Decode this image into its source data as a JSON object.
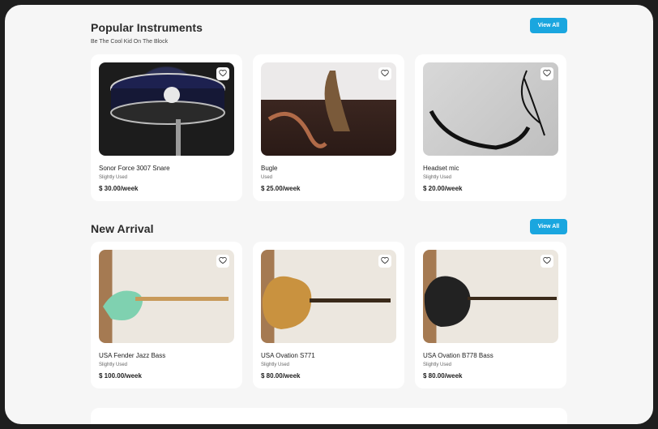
{
  "popular": {
    "title": "Popular Instruments",
    "subtitle": "Be The Cool Kid On The Block",
    "view_all": "View All",
    "items": [
      {
        "name": "Sonor Force 3007 Snare",
        "condition": "Slightly Used",
        "price": "$ 30.00/week"
      },
      {
        "name": "Bugle",
        "condition": "Used",
        "price": "$ 25.00/week"
      },
      {
        "name": "Headset mic",
        "condition": "Slightly Used",
        "price": "$ 20.00/week"
      }
    ]
  },
  "new_arrival": {
    "title": "New Arrival",
    "view_all": "View All",
    "items": [
      {
        "name": "USA Fender Jazz Bass",
        "condition": "Slightly Used",
        "price": "$ 100.00/week"
      },
      {
        "name": "USA Ovation S771",
        "condition": "Slightly Used",
        "price": "$ 80.00/week"
      },
      {
        "name": "USA Ovation B778 Bass",
        "condition": "Slightly Used",
        "price": "$ 80.00/week"
      }
    ]
  },
  "icons": {
    "favorite": "heart-icon"
  },
  "colors": {
    "accent": "#1aa6df",
    "background": "#f6f6f6",
    "card": "#ffffff"
  }
}
